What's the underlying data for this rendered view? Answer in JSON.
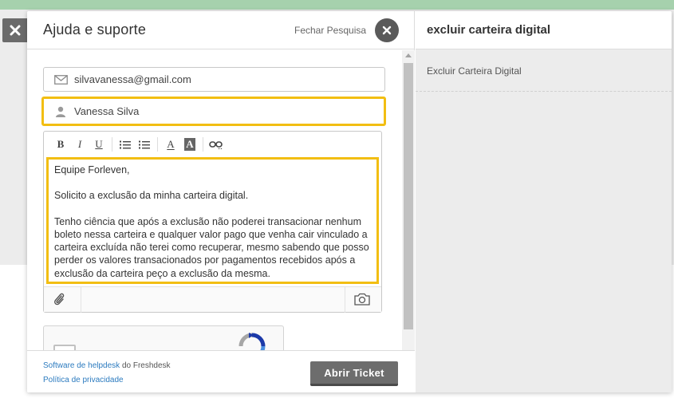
{
  "widget": {
    "title": "Ajuda e suporte",
    "close_search_label": "Fechar Pesquisa"
  },
  "form": {
    "email_value": "silvavanessa@gmail.com",
    "name_value": "Vanessa Silva",
    "toolbar": {
      "bold": "B",
      "italic": "I",
      "underline": "U",
      "font_color": "A",
      "bg_color": "A"
    },
    "message": {
      "p1": "Equipe Forleven,",
      "p2": "Solicito a exclusão da minha carteira digital.",
      "p3": "Tenho ciência que após a exclusão  não poderei transacionar nenhum boleto nessa carteira e qualquer valor pago que venha cair vinculado a carteira excluída não terei como recuperar, mesmo sabendo que posso perder os valores transacionados por pagamentos recebidos após a exclusão da carteira peço a exclusão da mesma."
    }
  },
  "footer": {
    "helpdesk_link": "Software de helpdesk",
    "helpdesk_suffix": " do Freshdesk",
    "privacy_link": "Política de privacidade",
    "submit_label": "Abrir Ticket"
  },
  "search_panel": {
    "query": "excluir carteira digital",
    "results": [
      {
        "label": "Excluir Carteira Digital"
      }
    ]
  },
  "icons": {
    "outer_close": "close-icon",
    "inner_close": "close-icon",
    "email": "envelope-icon",
    "user": "user-icon",
    "attach": "paperclip-icon",
    "camera": "camera-icon",
    "captcha": "recaptcha-icon"
  },
  "colors": {
    "highlight": "#f2be12",
    "button": "#6d6d6d",
    "link": "#2c7bbf",
    "top_bar": "#a6d1ad"
  }
}
